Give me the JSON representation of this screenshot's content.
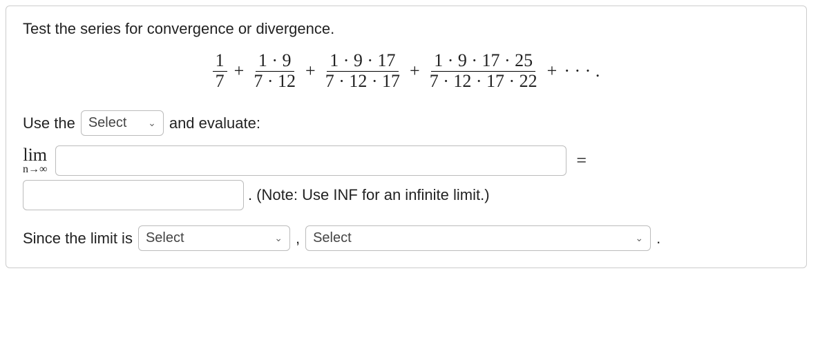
{
  "prompt": "Test the series for convergence or divergence.",
  "series": {
    "terms": [
      {
        "num": "1",
        "den": "7"
      },
      {
        "num": "1 · 9",
        "den": "7 · 12"
      },
      {
        "num": "1 · 9 · 17",
        "den": "7 · 12 · 17"
      },
      {
        "num": "1 · 9 · 17 · 25",
        "den": "7 · 12 · 17 · 22"
      }
    ],
    "plus": "+",
    "ellipsis": "· · · ."
  },
  "line1": {
    "use_the": "Use the",
    "select_placeholder": "Select",
    "and_eval": "and evaluate:"
  },
  "limit": {
    "lim": "lim",
    "sub": "n→∞",
    "equals": "="
  },
  "note": {
    "dot": ".",
    "text": "(Note: Use INF for an infinite limit.)"
  },
  "line3": {
    "since": "Since the limit is",
    "select1": "Select",
    "comma": ",",
    "select2": "Select",
    "end": "."
  }
}
